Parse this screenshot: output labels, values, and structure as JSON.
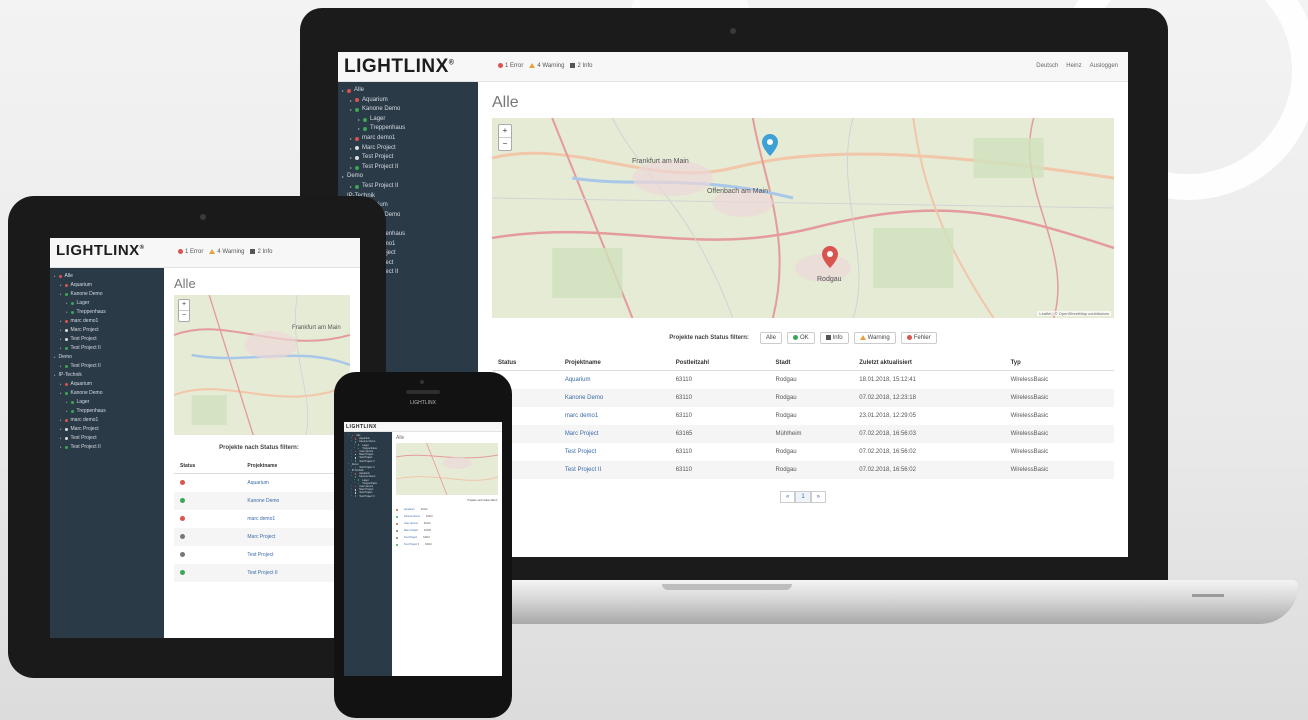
{
  "brand": {
    "logo_text": "LIGHTLINX",
    "logo_mark": "®"
  },
  "status_bar": {
    "errors": "1 Error",
    "warnings": "4 Warning",
    "infos": "2 Info",
    "error_color": "#d9534f",
    "warning_color": "#e6a23c",
    "info_color": "#555555"
  },
  "top_right": {
    "language": "Deutsch",
    "user": "Heinz",
    "logout": "Ausloggen"
  },
  "sidebar": {
    "items": [
      {
        "label": "Alle",
        "level": 0,
        "color": "#d9534f"
      },
      {
        "label": "Aquarium",
        "level": 1,
        "color": "#d9534f"
      },
      {
        "label": "Kanone Demo",
        "level": 1,
        "color": "#3aa757"
      },
      {
        "label": "Lager",
        "level": 2,
        "color": "#3aa757"
      },
      {
        "label": "Treppenhaus",
        "level": 2,
        "color": "#3aa757"
      },
      {
        "label": "marc demo1",
        "level": 1,
        "color": "#d9534f"
      },
      {
        "label": "Marc Project",
        "level": 1,
        "color": "#dddddd"
      },
      {
        "label": "Test Project",
        "level": 1,
        "color": "#dddddd"
      },
      {
        "label": "Test Project II",
        "level": 1,
        "color": "#3aa757"
      },
      {
        "label": "Demo",
        "level": 0,
        "color": ""
      },
      {
        "label": "Test Project II",
        "level": 1,
        "color": "#3aa757"
      },
      {
        "label": "IP-Technik",
        "level": 0,
        "color": ""
      },
      {
        "label": "Aquarium",
        "level": 1,
        "color": "#d9534f"
      },
      {
        "label": "Kanone Demo",
        "level": 1,
        "color": "#3aa757"
      },
      {
        "label": "Lager",
        "level": 2,
        "color": "#3aa757"
      },
      {
        "label": "Treppenhaus",
        "level": 2,
        "color": "#3aa757"
      },
      {
        "label": "marc demo1",
        "level": 1,
        "color": "#d9534f"
      },
      {
        "label": "Marc Project",
        "level": 1,
        "color": "#dddddd"
      },
      {
        "label": "Test Project",
        "level": 1,
        "color": "#dddddd"
      },
      {
        "label": "Test Project II",
        "level": 1,
        "color": "#3aa757"
      }
    ]
  },
  "main": {
    "title": "Alle",
    "map": {
      "labels": [
        "Frankfurt am Main",
        "Offenbach am Main",
        "Rodgau"
      ],
      "attribution": "Leaflet | © OpenStreetMap contributors",
      "zoom_in": "+",
      "zoom_out": "−",
      "marker_colors": [
        "#3da0d6",
        "#d9534f"
      ]
    },
    "filter": {
      "label": "Projekte nach Status filtern:",
      "buttons": [
        "Alle",
        "OK",
        "Info",
        "Warning",
        "Fehler"
      ]
    },
    "table": {
      "headers": [
        "Status",
        "Projektname",
        "Postleitzahl",
        "Stadt",
        "Zuletzt aktualisiert",
        "Typ"
      ],
      "rows": [
        {
          "status_color": "#d9534f",
          "name": "Aquarium",
          "plz": "63110",
          "city": "Rodgau",
          "updated": "18.01.2018, 15:12:41",
          "type": "WirelessBasic"
        },
        {
          "status_color": "#3aa757",
          "name": "Kanone Demo",
          "plz": "63110",
          "city": "Rodgau",
          "updated": "07.02.2018, 12:23:18",
          "type": "WirelessBasic"
        },
        {
          "status_color": "#d9534f",
          "name": "marc demo1",
          "plz": "63110",
          "city": "Rodgau",
          "updated": "23.01.2018, 12:29:05",
          "type": "WirelessBasic"
        },
        {
          "status_color": "#777777",
          "name": "Marc Project",
          "plz": "63165",
          "city": "Mühlheim",
          "updated": "07.02.2018, 16:56:03",
          "type": "WirelessBasic"
        },
        {
          "status_color": "#777777",
          "name": "Test Project",
          "plz": "63110",
          "city": "Rodgau",
          "updated": "07.02.2018, 16:56:02",
          "type": "WirelessBasic"
        },
        {
          "status_color": "#3aa757",
          "name": "Test Project II",
          "plz": "63110",
          "city": "Rodgau",
          "updated": "07.02.2018, 16:56:02",
          "type": "WirelessBasic"
        }
      ]
    },
    "pager": {
      "prev": "«",
      "current": "1",
      "next": "»"
    }
  },
  "phone": {
    "header_text": "LIGHTLINX"
  }
}
